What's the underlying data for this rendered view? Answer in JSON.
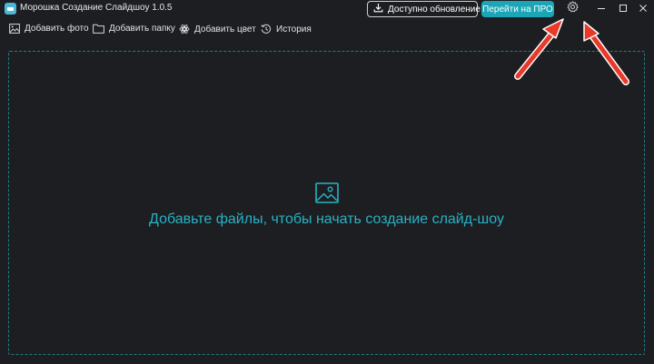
{
  "window": {
    "title": "Морошка Создание Слайдшоу 1.0.5"
  },
  "header": {
    "update_label": "Доступно обновление!",
    "pro_label": "Перейти на ПРО",
    "icons": {
      "update": "download-icon",
      "settings": "gear-icon",
      "minimize": "minimize-icon",
      "maximize": "maximize-icon",
      "close": "close-icon"
    }
  },
  "toolbar": {
    "items": [
      {
        "label": "Добавить фото",
        "icon": "image-icon"
      },
      {
        "label": "Добавить папку",
        "icon": "folder-icon"
      },
      {
        "label": "Добавить цвет",
        "icon": "color-icon"
      },
      {
        "label": "История",
        "icon": "history-icon"
      }
    ]
  },
  "main": {
    "empty_text": "Добавьте файлы, чтобы начать создание слайд-шоу",
    "empty_icon": "image-icon"
  },
  "colors": {
    "background": "#1d1e21",
    "accent": "#1aa6b7",
    "accent_text": "#27b3c5",
    "annotation_arrow": "#e8392a"
  }
}
